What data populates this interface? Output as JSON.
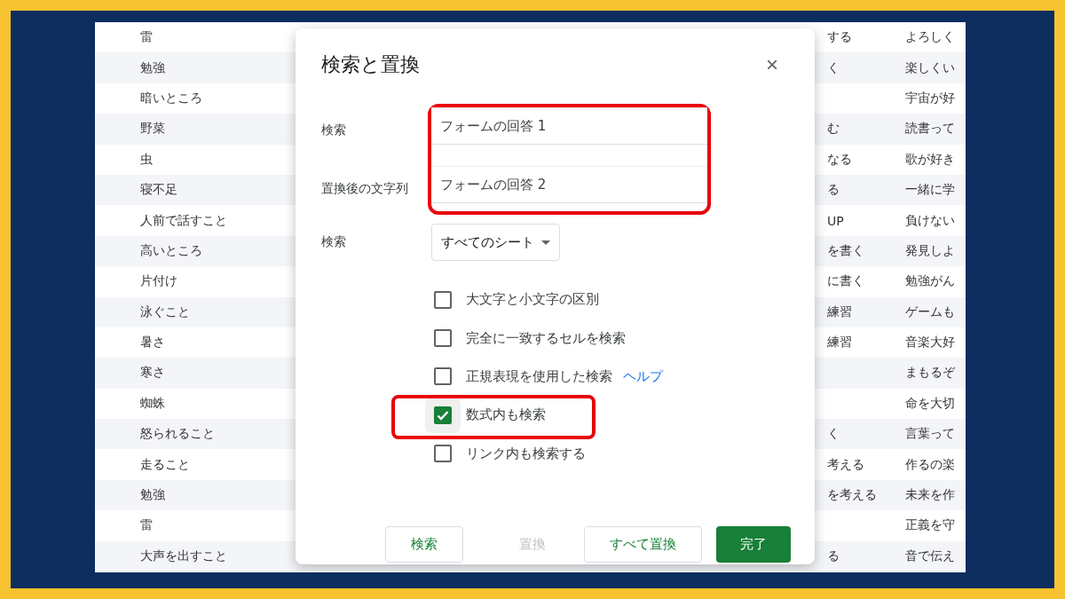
{
  "sheet": {
    "rows": [
      {
        "column_1": "雷",
        "column_2": "する",
        "column_3": "よろしく"
      },
      {
        "column_1": "勉強",
        "column_2": "く",
        "column_3": "楽しくい"
      },
      {
        "column_1": "暗いところ",
        "column_3": "宇宙が好"
      },
      {
        "column_1": "野菜",
        "column_2": "む",
        "column_3": "読書って"
      },
      {
        "column_1": "虫",
        "column_2": "なる",
        "column_3": "歌が好き"
      },
      {
        "column_1": "寝不足",
        "column_2": "る",
        "column_3": "一緒に学"
      },
      {
        "column_1": "人前で話すこと",
        "column_2": "UP",
        "column_3": "負けない"
      },
      {
        "column_1": "高いところ",
        "column_2": "を書く",
        "column_3": "発見しよ"
      },
      {
        "column_1": "片付け",
        "column_2": "に書く",
        "column_3": "勉強がん"
      },
      {
        "column_1": "泳ぐこと",
        "column_2": "練習",
        "column_3": "ゲームも"
      },
      {
        "column_1": "暑さ",
        "column_2": "練習",
        "column_3": "音楽大好"
      },
      {
        "column_1": "寒さ",
        "column_3": "まもるぞ"
      },
      {
        "column_1": "蜘蛛",
        "column_3": "命を大切"
      },
      {
        "column_1": "怒られること",
        "column_2": "く",
        "column_3": "言葉って"
      },
      {
        "column_1": "走ること",
        "column_2": "考える",
        "column_3": "作るの楽"
      },
      {
        "column_1": "勉強",
        "column_2": "を考える",
        "column_3": "未来を作"
      },
      {
        "column_1": "雷",
        "column_3": "正義を守"
      },
      {
        "column_1": "大声を出すこと",
        "column_2": "る",
        "column_3": "音で伝え"
      }
    ]
  },
  "dialog": {
    "title": "検索と置換",
    "close": "×",
    "find": {
      "label": "検索",
      "value": "フォームの回答 1"
    },
    "replace": {
      "label": "置換後の文字列",
      "value": "フォームの回答 2"
    },
    "fields_highlighted": true,
    "scope": {
      "label": "検索",
      "value": "すべてのシート"
    },
    "options": [
      {
        "label": "大文字と小文字の区別",
        "checked": false,
        "highlighted": false
      },
      {
        "label": "完全に一致するセルを検索",
        "checked": false,
        "highlighted": false
      },
      {
        "label": "正規表現を使用した検索",
        "checked": false,
        "highlighted": false,
        "link": "ヘルプ"
      },
      {
        "label": "数式内も検索",
        "checked": true,
        "highlighted": true
      },
      {
        "label": "リンク内も検索する",
        "checked": false,
        "highlighted": false
      }
    ],
    "buttons": [
      {
        "label": "検索",
        "kind": "outlined",
        "disabled": false
      },
      {
        "label": "置換",
        "kind": "text",
        "disabled": true
      },
      {
        "label": "すべて置換",
        "kind": "outlined",
        "disabled": false
      },
      {
        "label": "完了",
        "kind": "primary",
        "disabled": false
      }
    ]
  }
}
